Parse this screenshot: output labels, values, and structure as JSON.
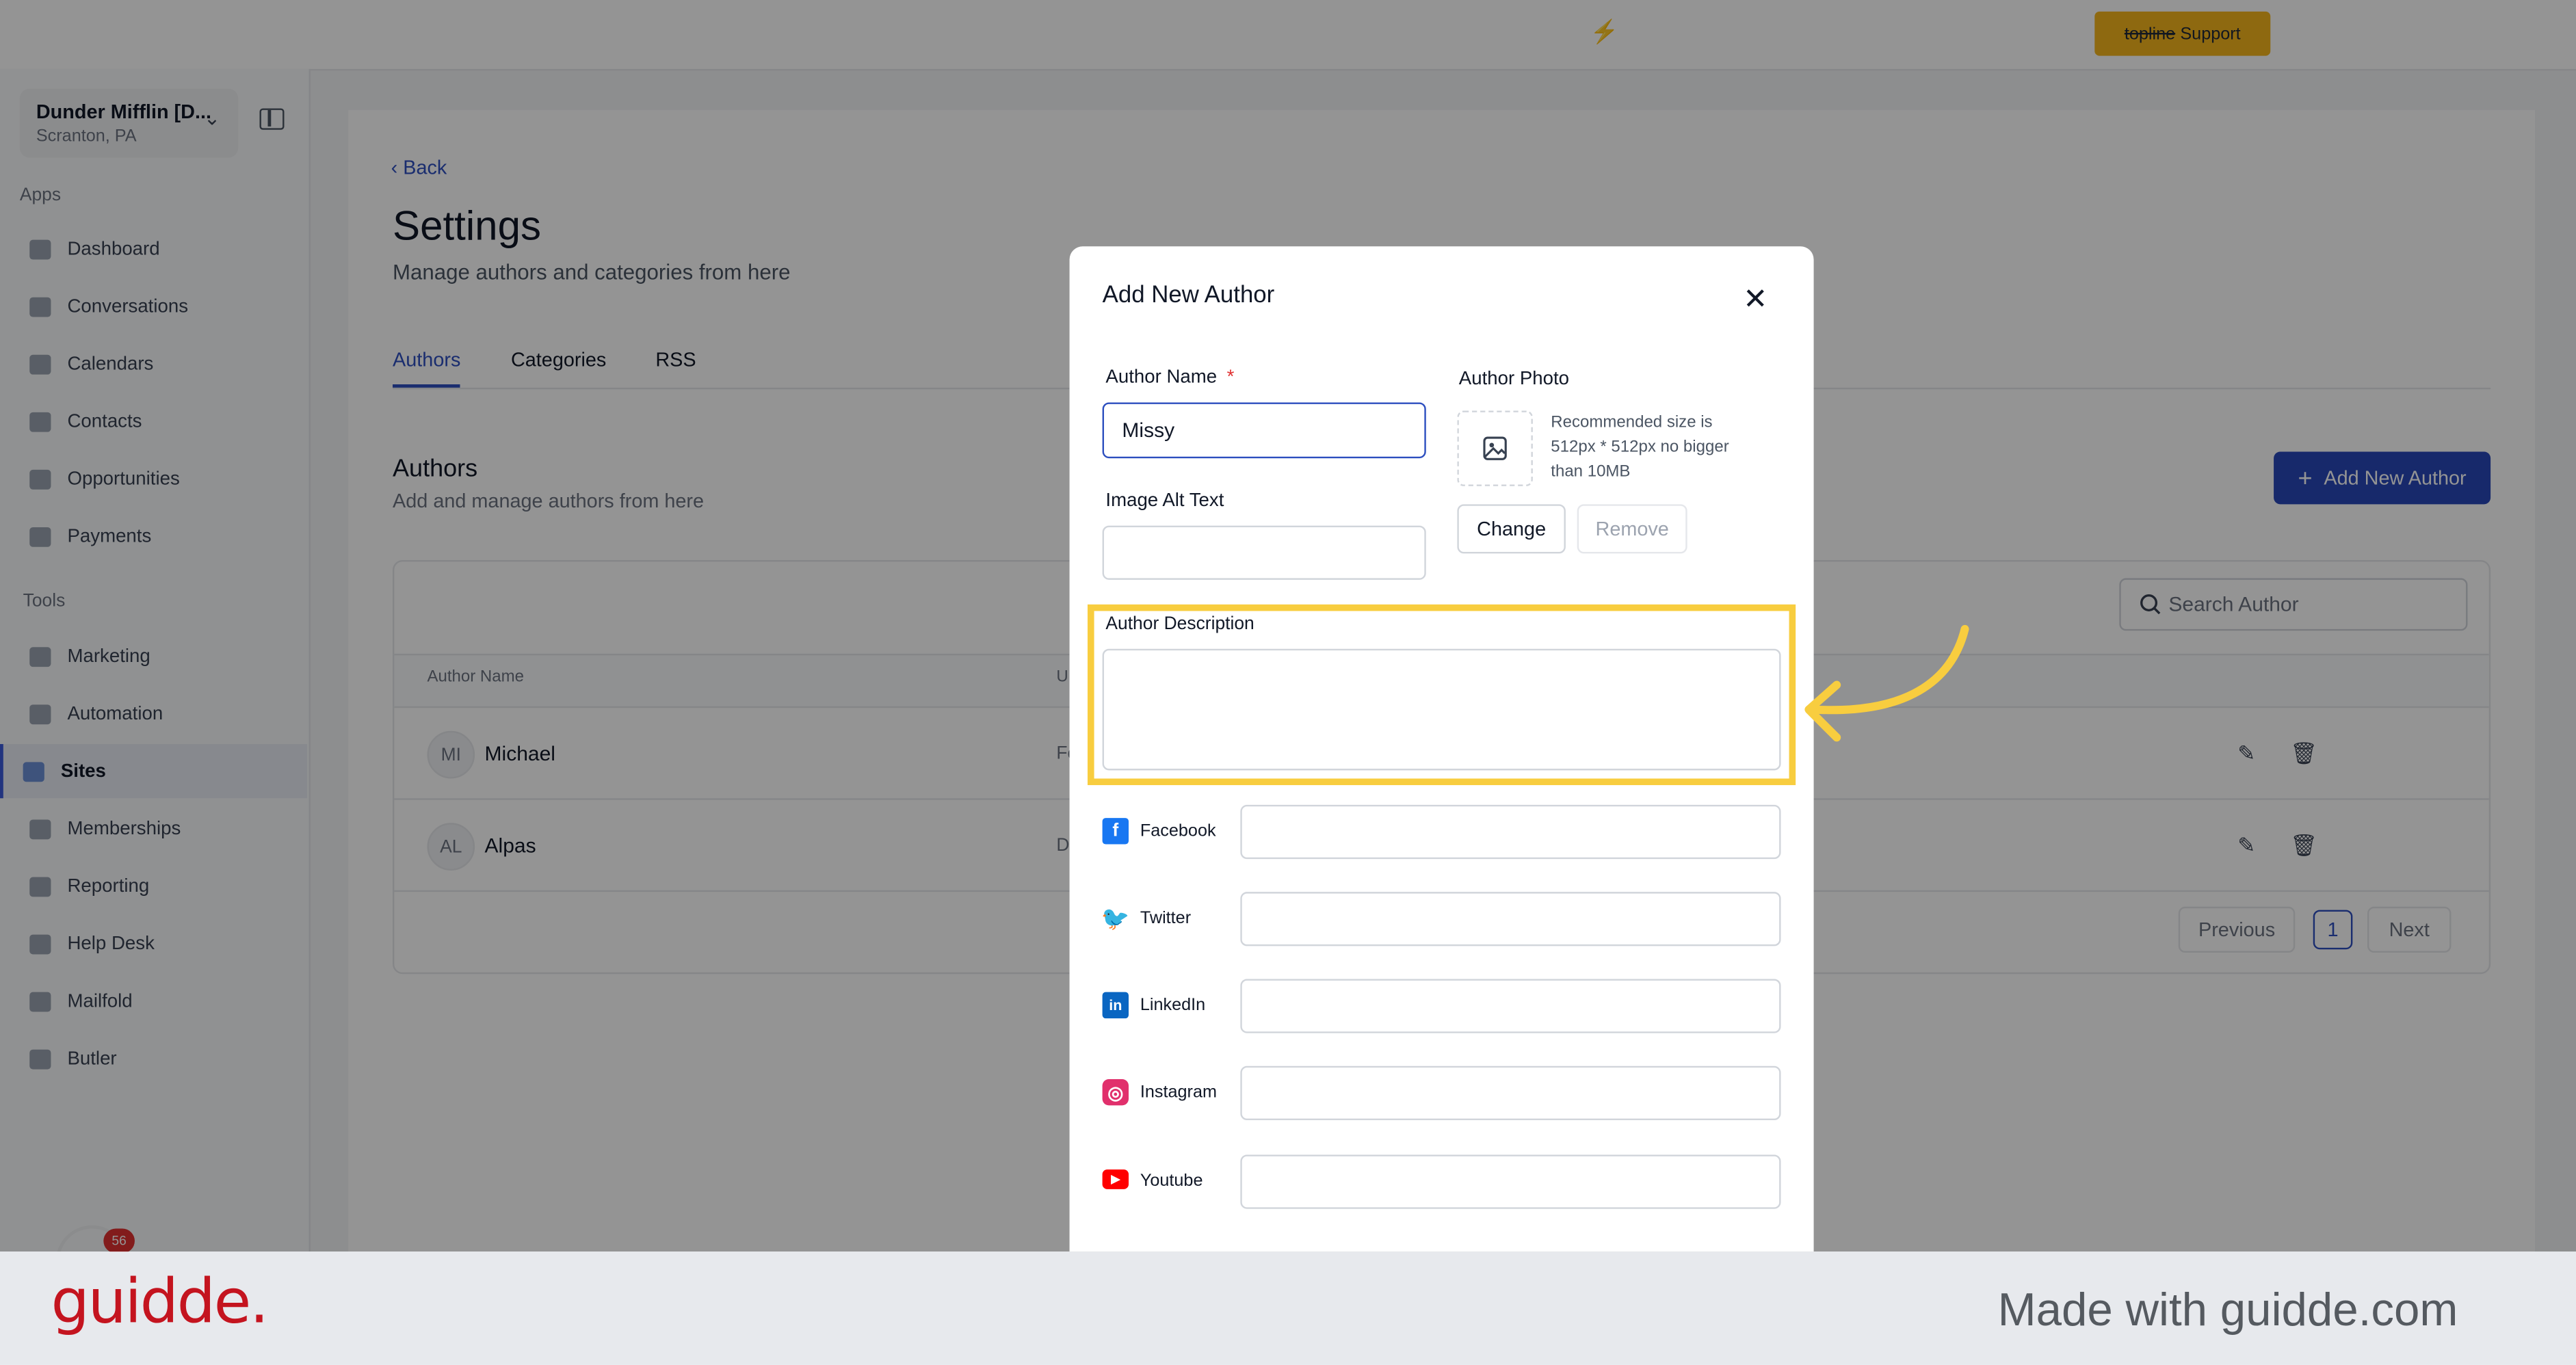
{
  "topbar": {
    "support_brand": "topline",
    "support_label": "Support"
  },
  "location": {
    "name": "Dunder Mifflin [D...",
    "city": "Scranton, PA"
  },
  "sidebar": {
    "apps_label": "Apps",
    "apps": [
      {
        "label": "Dashboard"
      },
      {
        "label": "Conversations"
      },
      {
        "label": "Calendars"
      },
      {
        "label": "Contacts"
      },
      {
        "label": "Opportunities"
      },
      {
        "label": "Payments"
      }
    ],
    "tools_label": "Tools",
    "tools": [
      {
        "label": "Marketing"
      },
      {
        "label": "Automation"
      },
      {
        "label": "Sites",
        "active": true
      },
      {
        "label": "Memberships"
      },
      {
        "label": "Reporting"
      },
      {
        "label": "Help Desk"
      },
      {
        "label": "Mailfold"
      },
      {
        "label": "Butler"
      }
    ],
    "notification_count": "56"
  },
  "page": {
    "back_label": "Back",
    "title": "Settings",
    "subtitle": "Manage authors and categories from here",
    "tabs": [
      {
        "label": "Authors",
        "active": true
      },
      {
        "label": "Categories"
      },
      {
        "label": "RSS"
      }
    ],
    "section_title": "Authors",
    "section_subtitle": "Add and manage authors from here",
    "add_button": "Add New Author",
    "search_placeholder": "Search Author",
    "table": {
      "columns": [
        "Author Name",
        "U"
      ],
      "rows": [
        {
          "initials": "MI",
          "name": "Michael",
          "col2": "Fe"
        },
        {
          "initials": "AL",
          "name": "Alpas",
          "col2": "D"
        }
      ]
    },
    "pagination": {
      "previous": "Previous",
      "current": "1",
      "next": "Next"
    }
  },
  "modal": {
    "title": "Add New Author",
    "author_name_label": "Author Name",
    "required_mark": "*",
    "author_name_value": "Missy",
    "image_alt_label": "Image Alt Text",
    "author_photo_label": "Author Photo",
    "photo_hint": "Recommended size is 512px * 512px no bigger than 10MB",
    "change_button": "Change",
    "remove_button": "Remove",
    "description_label": "Author Description",
    "socials": [
      {
        "label": "Facebook",
        "color": "#1877f2"
      },
      {
        "label": "Twitter",
        "color": "#1d9bf0"
      },
      {
        "label": "LinkedIn",
        "color": "#0a66c2"
      },
      {
        "label": "Instagram",
        "color": "#e1306c"
      },
      {
        "label": "Youtube",
        "color": "#ff0000"
      }
    ]
  },
  "annotation": {
    "highlight_color": "#f8cd3f"
  },
  "footer": {
    "logo": "guidde.",
    "tagline": "Made with guidde.com"
  }
}
